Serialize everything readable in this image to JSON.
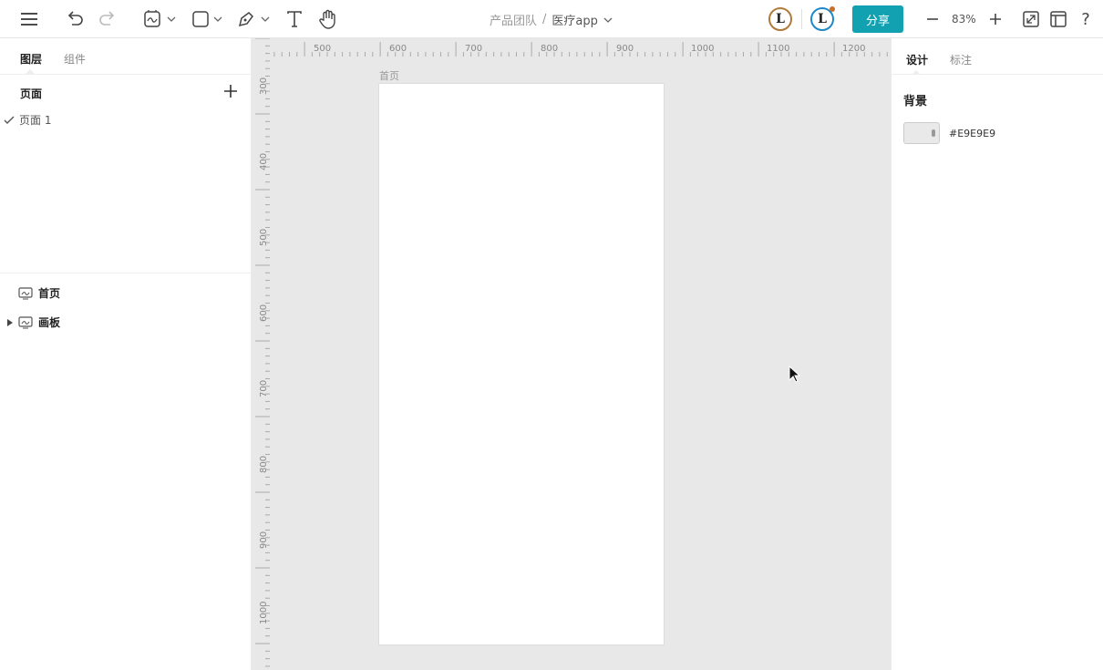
{
  "toolbar": {
    "menu_icon": "hamburger-icon",
    "undo_icon": "undo-icon",
    "redo_icon": "redo-icon",
    "frame_tool_icon": "frame-icon",
    "shape_tool_icon": "rectangle-icon",
    "pen_tool_icon": "pen-icon",
    "text_tool_icon": "text-icon",
    "hand_tool_icon": "hand-icon"
  },
  "breadcrumb": {
    "team": "产品团队",
    "separator": "/",
    "project": "医疗app"
  },
  "share_label": "分享",
  "zoom": {
    "minus": "−",
    "value": "83%",
    "plus": "+"
  },
  "colors": {
    "accent": "#11A1B0",
    "canvas_bg": "#E8E8E8",
    "artboard": "#FFFFFF"
  },
  "left_panel": {
    "tabs": [
      {
        "label": "图层"
      },
      {
        "label": "组件"
      }
    ],
    "pages_title": "页面",
    "pages": [
      {
        "label": "页面 1"
      }
    ],
    "layers": [
      {
        "label": "首页"
      },
      {
        "label": "画板"
      }
    ]
  },
  "canvas": {
    "ruler_top": [
      "500",
      "600",
      "700",
      "800",
      "900",
      "1000",
      "1100",
      "1200"
    ],
    "ruler_left": [
      "300",
      "400",
      "500",
      "600",
      "700",
      "800",
      "900",
      "1000"
    ],
    "artboard_title": "首页"
  },
  "right_panel": {
    "tabs": [
      {
        "label": "设计"
      },
      {
        "label": "标注"
      }
    ],
    "background_title": "背景",
    "background_hex": "#E9E9E9"
  }
}
